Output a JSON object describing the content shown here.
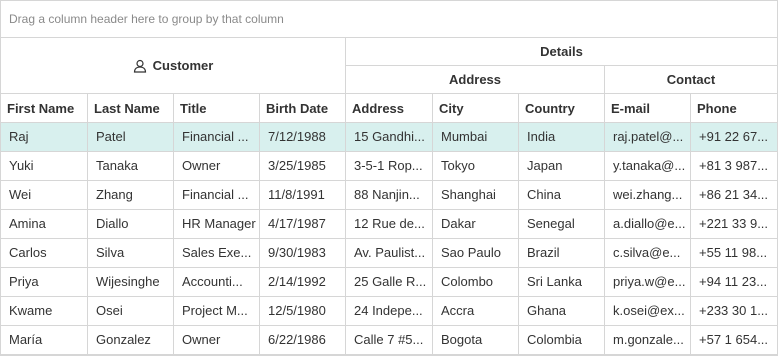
{
  "group_panel": {
    "placeholder": "Drag a column header here to group by that column"
  },
  "headers": {
    "customer": "Customer",
    "details": "Details",
    "address_group": "Address",
    "contact_group": "Contact",
    "columns": [
      "First Name",
      "Last Name",
      "Title",
      "Birth Date",
      "Address",
      "City",
      "Country",
      "E-mail",
      "Phone"
    ]
  },
  "icons": {
    "customer": "user-icon"
  },
  "colors": {
    "selected_row": "#d8f0ee"
  },
  "rows": [
    [
      "Raj",
      "Patel",
      "Financial ...",
      "7/12/1988",
      "15 Gandhi...",
      "Mumbai",
      "India",
      "raj.patel@...",
      "+91 22 67..."
    ],
    [
      "Yuki",
      "Tanaka",
      "Owner",
      "3/25/1985",
      "3-5-1 Rop...",
      "Tokyo",
      "Japan",
      "y.tanaka@...",
      "+81 3 987..."
    ],
    [
      "Wei",
      "Zhang",
      "Financial ...",
      "11/8/1991",
      "88 Nanjin...",
      "Shanghai",
      "China",
      "wei.zhang...",
      "+86 21 34..."
    ],
    [
      "Amina",
      "Diallo",
      "HR Manager",
      "4/17/1987",
      "12 Rue de...",
      "Dakar",
      "Senegal",
      "a.diallo@e...",
      "+221 33 9..."
    ],
    [
      "Carlos",
      "Silva",
      "Sales Exe...",
      "9/30/1983",
      "Av. Paulist...",
      "Sao Paulo",
      "Brazil",
      "c.silva@e...",
      "+55 11 98..."
    ],
    [
      "Priya",
      "Wijesinghe",
      "Accounti...",
      "2/14/1992",
      "25 Galle R...",
      "Colombo",
      "Sri Lanka",
      "priya.w@e...",
      "+94 11 23..."
    ],
    [
      "Kwame",
      "Osei",
      "Project M...",
      "12/5/1980",
      "24 Indepe...",
      "Accra",
      "Ghana",
      "k.osei@ex...",
      "+233 30 1..."
    ],
    [
      "María",
      "Gonzalez",
      "Owner",
      "6/22/1986",
      "Calle 7 #5...",
      "Bogota",
      "Colombia",
      "m.gonzale...",
      "+57 1 654..."
    ]
  ],
  "selected_row": 0
}
